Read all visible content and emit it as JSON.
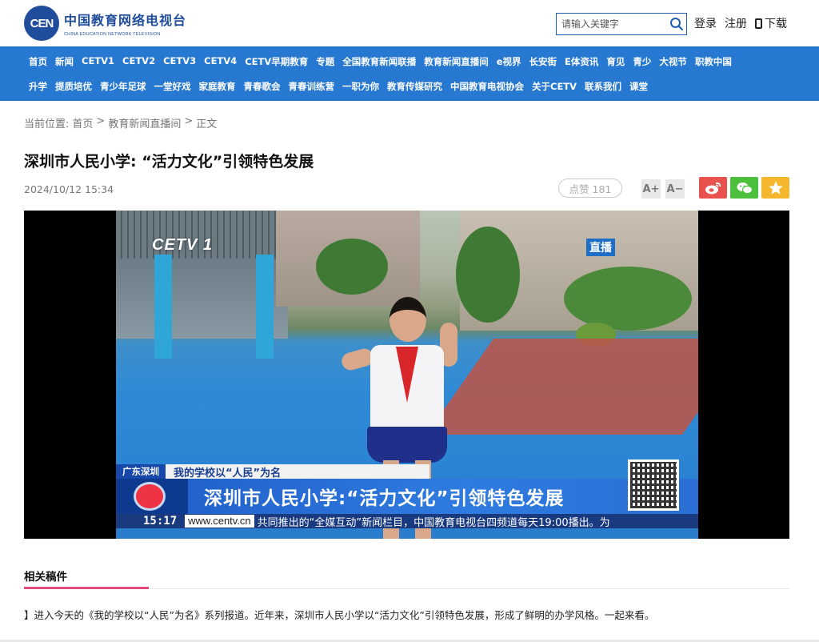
{
  "header": {
    "logo_badge": "CEN",
    "logo_cn": "中国教育网络电视台",
    "logo_en": "CHINA EDUCATION NETWORK TELEVISION",
    "search_placeholder": "请输入关键字",
    "login": "登录",
    "register": "注册",
    "download": "下载"
  },
  "nav": {
    "row1": [
      "首页",
      "新闻",
      "CETV1",
      "CETV2",
      "CETV3",
      "CETV4",
      "CETV早期教育",
      "专题",
      "全国教育新闻联播",
      "教育新闻直播间",
      "e视界",
      "长安街",
      "E体资讯",
      "育见",
      "青少",
      "大视节",
      "职教中国"
    ],
    "row2": [
      "升学",
      "提质培优",
      "青少年足球",
      "一堂好戏",
      "家庭教育",
      "青春歌会",
      "青春训练营",
      "一职为你",
      "教育传媒研究",
      "中国教育电视协会",
      "关于CETV",
      "联系我们",
      "课堂"
    ]
  },
  "breadcrumb": {
    "prefix": "当前位置:",
    "home": "首页",
    "sep": ">",
    "section": "教育新闻直播间",
    "current": "正文"
  },
  "article": {
    "title": "深圳市人民小学: “活力文化”引领特色发展",
    "date": "2024/10/12 15:34",
    "likes": "点赞 181",
    "font_up": "A+",
    "font_down": "A−"
  },
  "video": {
    "channel": "CETV 1",
    "live": "直播",
    "location": "广东深圳",
    "topic": "我的学校以“人民”为名",
    "headline": "深圳市人民小学:“活力文化”引领特色发展",
    "time": "15:17",
    "url": "www.centv.cn",
    "ticker": "共同推出的“全媒互动”新闻栏目，中国教育电视台四频道每天19:00播出。为"
  },
  "related": {
    "heading": "相关稿件",
    "summary": "】进入今天的《我的学校以“人民”为名》系列报道。近年来，深圳市人民小学以“活力文化”引领特色发展，形成了鲜明的办学风格。一起来看。"
  },
  "colors": {
    "brand_blue": "#1f4d9c",
    "nav_blue": "#2678d0",
    "weibo": "#e8514d",
    "wechat": "#4cbf3c",
    "favorite": "#f5b72e",
    "accent_pink": "#e24a7a"
  },
  "icons": {
    "search": "search-icon",
    "download": "phone-icon",
    "weibo": "weibo-icon",
    "wechat": "wechat-icon",
    "favorite": "star-icon"
  }
}
